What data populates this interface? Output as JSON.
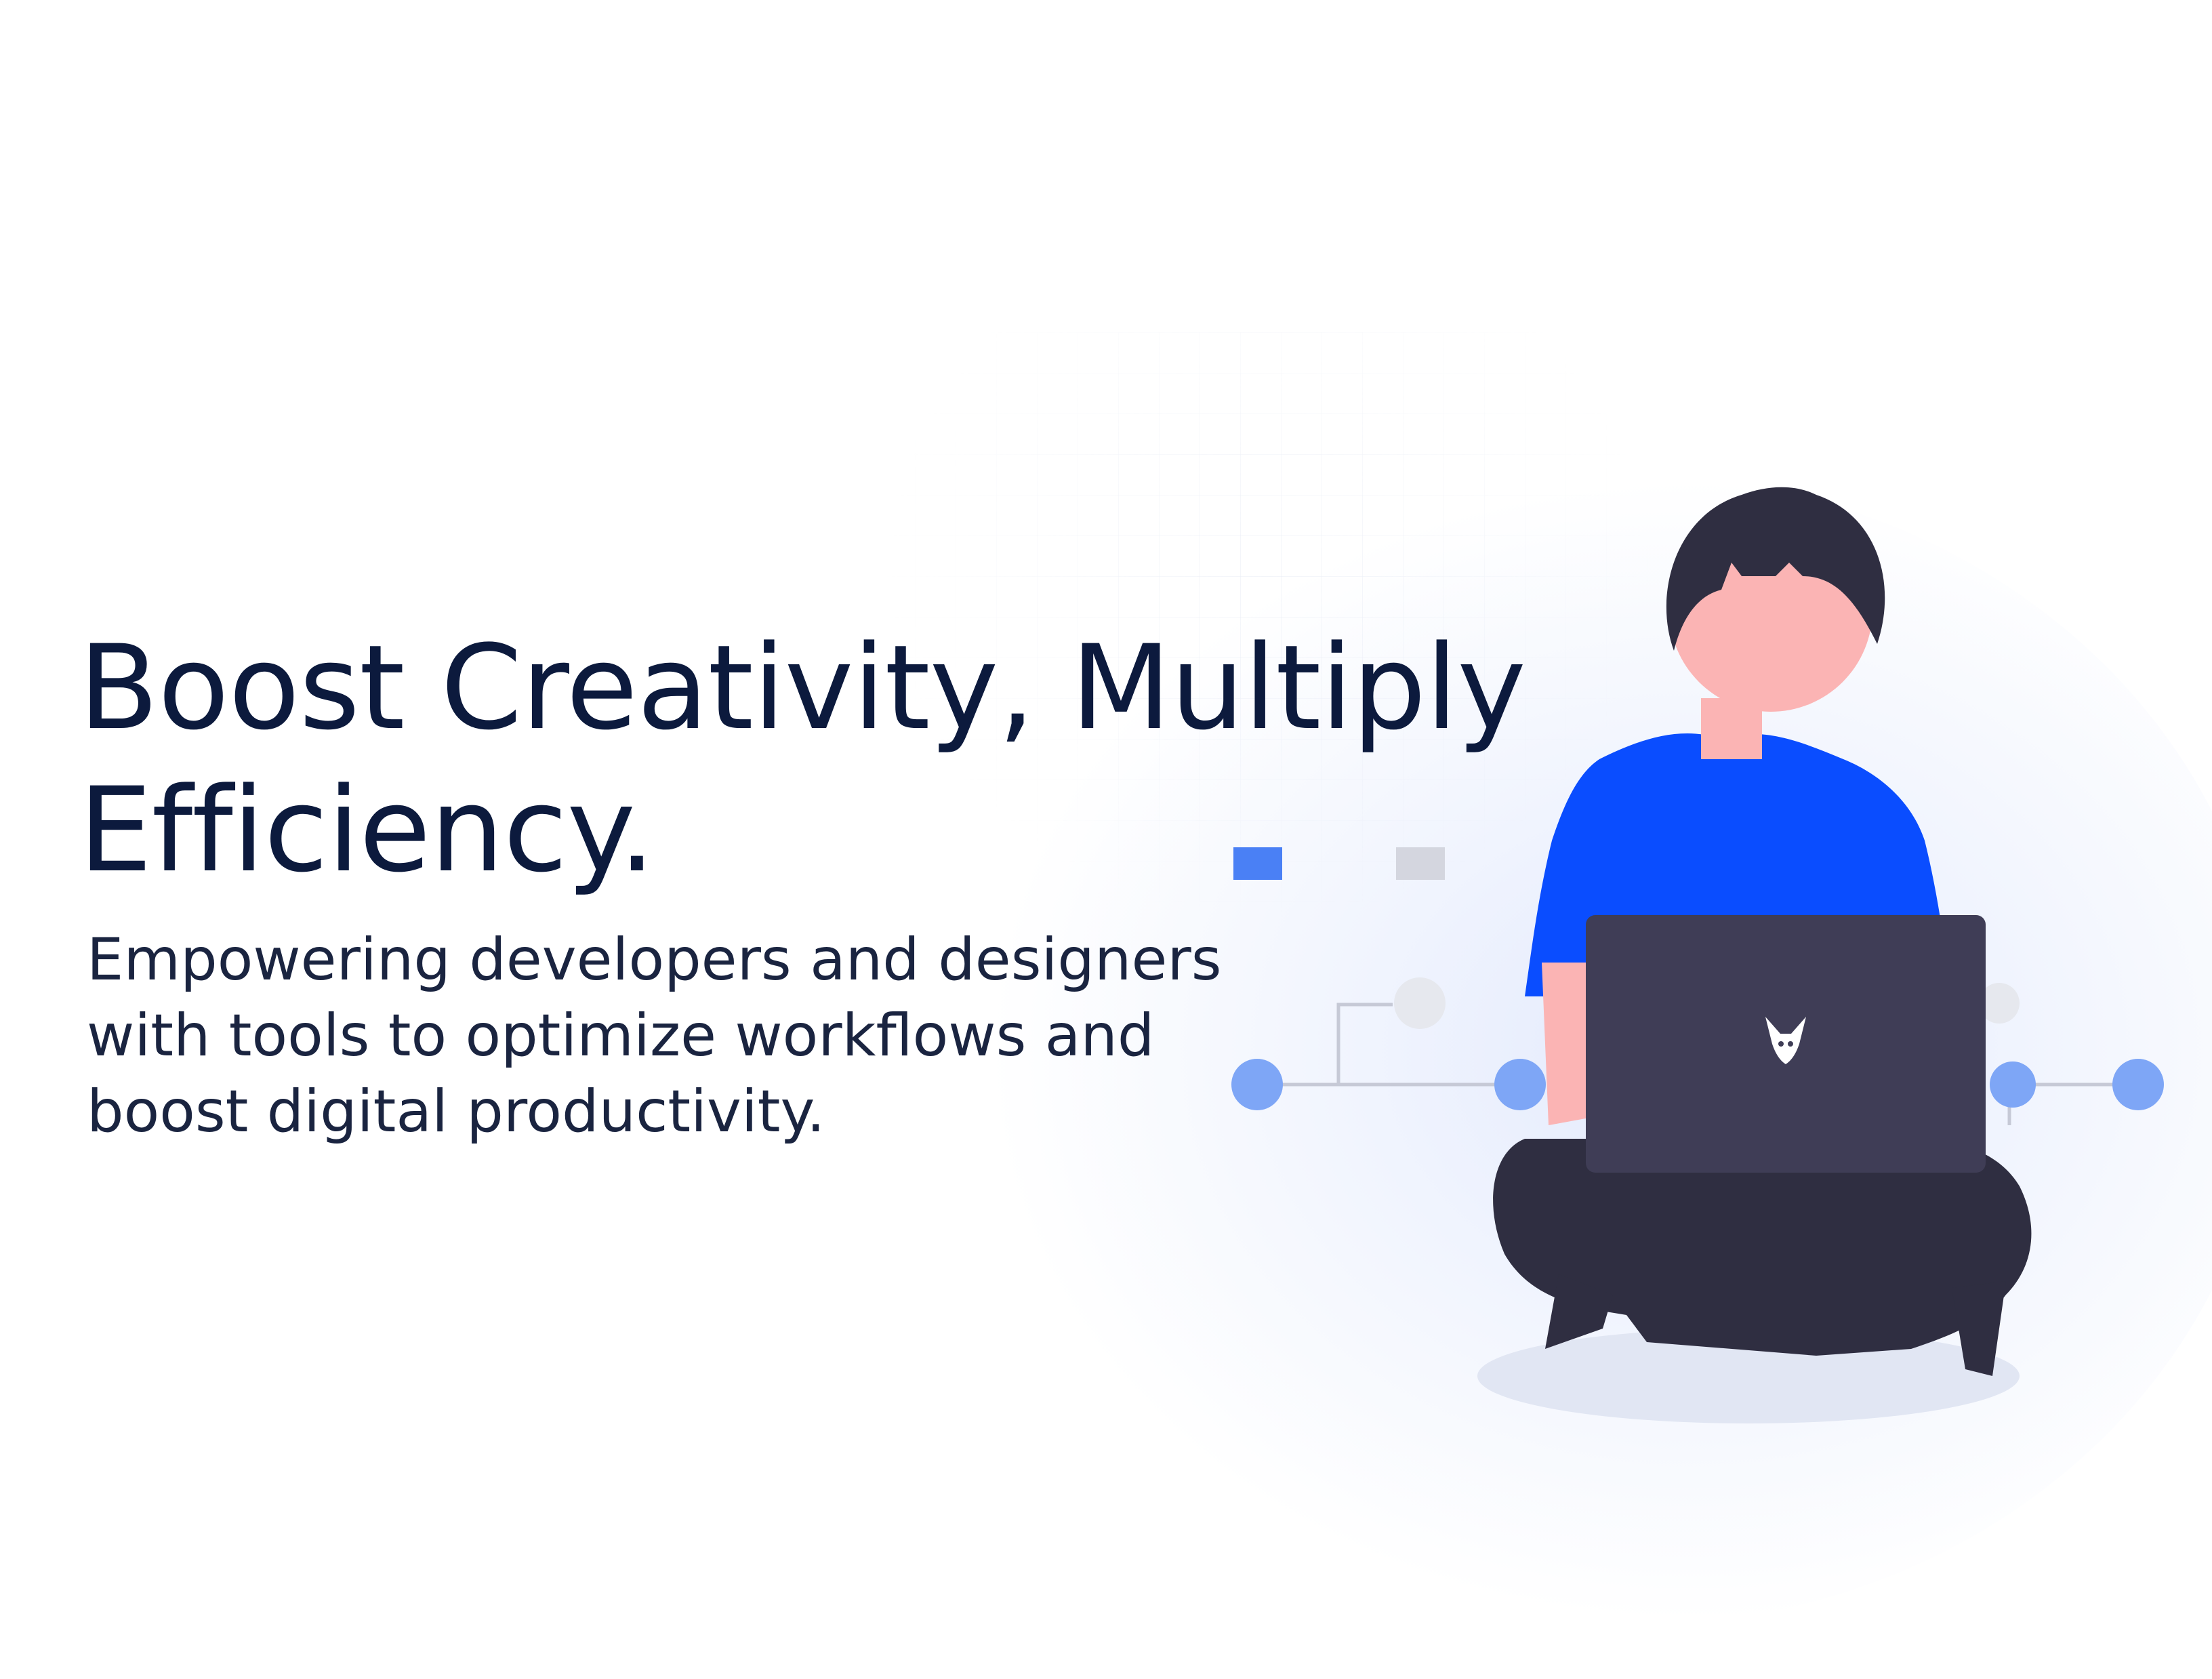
{
  "hero": {
    "headline_line1": "Boost Creativity, Multiply",
    "headline_line2": "Efficiency.",
    "subhead_line1": "Empowering developers and designers",
    "subhead_line2": "with tools to optimize workflows and",
    "subhead_line3": "boost digital productivity."
  },
  "illustration": {
    "icons": {
      "person": "person-with-laptop-illustration",
      "laptop_logo": "fox-logo-icon"
    },
    "colors": {
      "shirt": "#0a4dff",
      "hair": "#2f2e41",
      "skin": "#fbb4b4",
      "laptop": "#3f3d56",
      "node": "#7ea6f6",
      "square_blue": "#4a80f5",
      "square_gray": "#d4d6df"
    }
  }
}
